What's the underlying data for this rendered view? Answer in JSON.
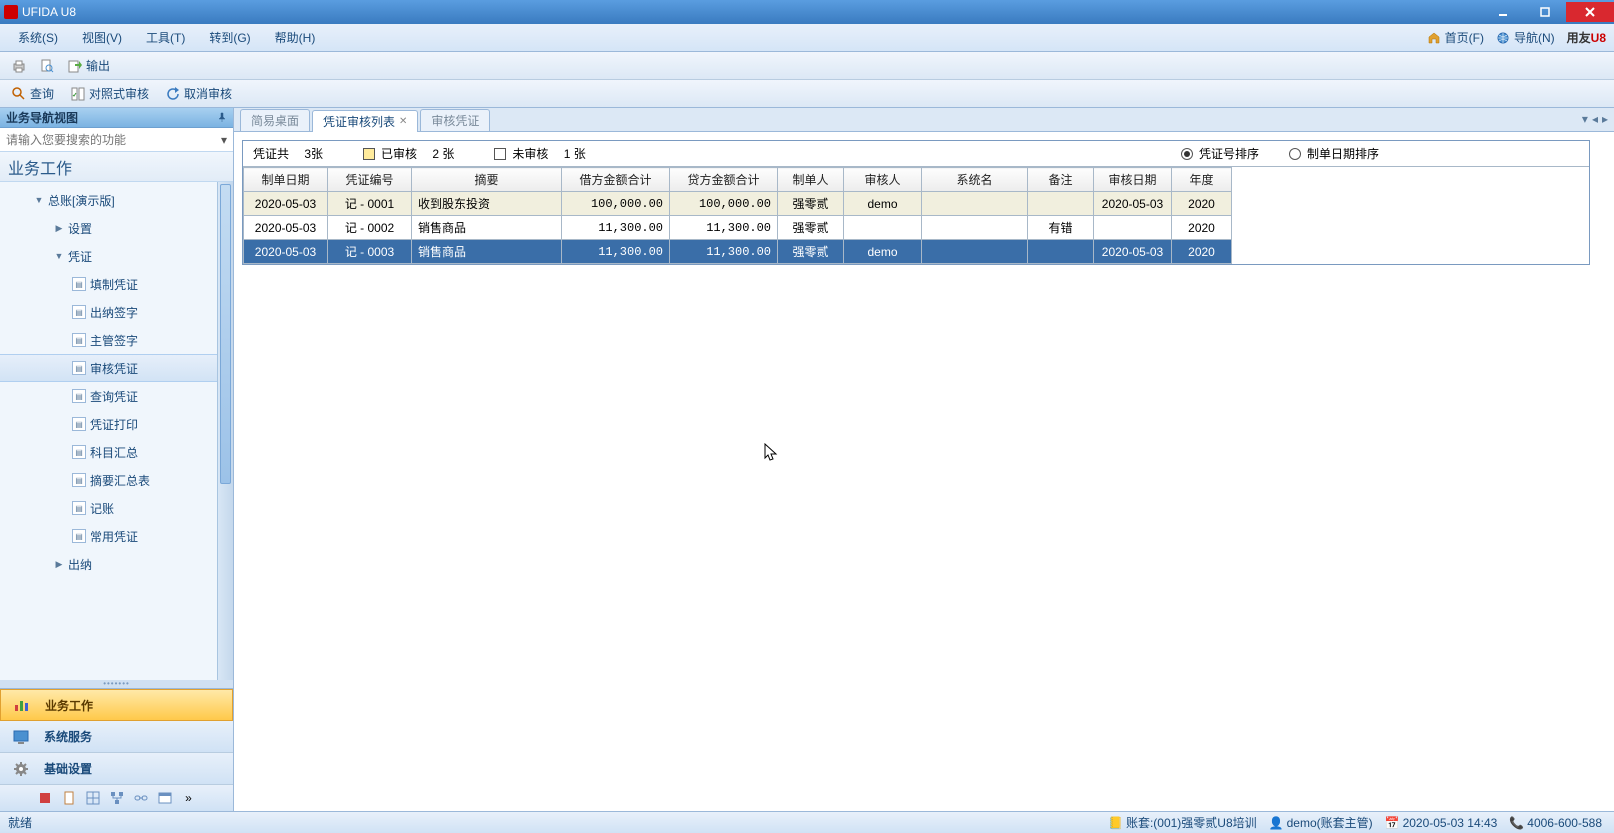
{
  "title": "UFIDA U8",
  "menubar": {
    "items": [
      "系统(S)",
      "视图(V)",
      "工具(T)",
      "转到(G)",
      "帮助(H)"
    ],
    "right": {
      "home": "首页(F)",
      "nav": "导航(N)",
      "brand1": "用友",
      "brand2": "U8"
    }
  },
  "toolbar1": {
    "export": "输出"
  },
  "toolbar2": {
    "query": "查询",
    "compare": "对照式审核",
    "cancel": "取消审核"
  },
  "sidebar": {
    "head": "业务导航视图",
    "search_placeholder": "请输入您要搜索的功能",
    "title": "业务工作",
    "tree": {
      "root": "总账[演示版]",
      "n1": "设置",
      "n2": "凭证",
      "leafs": [
        "填制凭证",
        "出纳签字",
        "主管签字",
        "审核凭证",
        "查询凭证",
        "凭证打印",
        "科目汇总",
        "摘要汇总表",
        "记账",
        "常用凭证"
      ],
      "n3": "出纳"
    },
    "navbtns": [
      "业务工作",
      "系统服务",
      "基础设置"
    ]
  },
  "tabs": {
    "t1": "简易桌面",
    "t2": "凭证审核列表",
    "t3": "审核凭证"
  },
  "filter": {
    "total_l": "凭证共",
    "total_v": "3张",
    "audited_l": "已审核",
    "audited_v": "2 张",
    "unaudited_l": "未审核",
    "unaudited_v": "1 张",
    "sort1": "凭证号排序",
    "sort2": "制单日期排序"
  },
  "columns": [
    "制单日期",
    "凭证编号",
    "摘要",
    "借方金额合计",
    "贷方金额合计",
    "制单人",
    "审核人",
    "系统名",
    "备注",
    "审核日期",
    "年度"
  ],
  "rows": [
    {
      "date": "2020-05-03",
      "no": "记 - 0001",
      "sum": "收到股东投资",
      "dr": "100,000.00",
      "cr": "100,000.00",
      "maker": "强零贰",
      "aud": "demo",
      "sys": "",
      "note": "",
      "adate": "2020-05-03",
      "year": "2020",
      "cls": "audited"
    },
    {
      "date": "2020-05-03",
      "no": "记 - 0002",
      "sum": "销售商品",
      "dr": "11,300.00",
      "cr": "11,300.00",
      "maker": "强零贰",
      "aud": "",
      "sys": "",
      "note": "有错",
      "adate": "",
      "year": "2020",
      "cls": ""
    },
    {
      "date": "2020-05-03",
      "no": "记 - 0003",
      "sum": "销售商品",
      "dr": "11,300.00",
      "cr": "11,300.00",
      "maker": "强零贰",
      "aud": "demo",
      "sys": "",
      "note": "",
      "adate": "2020-05-03",
      "year": "2020",
      "cls": "selected"
    }
  ],
  "status": {
    "ready": "就绪",
    "acct": "账套:(001)强零贰U8培训",
    "user": "demo(账套主管)",
    "datetime": "2020-05-03 14:43",
    "phone": "4006-600-588"
  }
}
